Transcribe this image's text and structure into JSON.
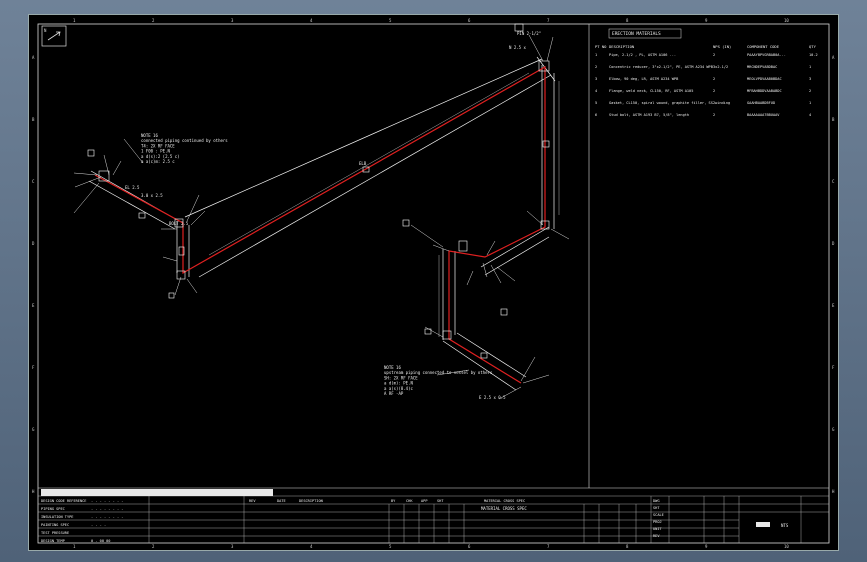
{
  "sheet": {
    "zones_top": [
      "1",
      "2",
      "3",
      "4",
      "5",
      "6",
      "7",
      "8",
      "9",
      "10"
    ],
    "zones_side": [
      "A",
      "B",
      "C",
      "D",
      "E",
      "F",
      "G",
      "H"
    ]
  },
  "bom": {
    "title": "ERECTION MATERIALS",
    "headers": [
      "PT NO",
      "DESCRIPTION",
      "NPS (IN)",
      "COMPONENT CODE",
      "QTY"
    ],
    "rows": [
      {
        "no": "1",
        "desc": "Pipe, 2-1/2 , PL, ASTM A106 ...",
        "nps": "2",
        "code": "PAAAYBPVGRBAB0A...",
        "qty": "10.2"
      },
      {
        "no": "2",
        "desc": "Concentric reducer, 3\"x2-1/2\", PE, ASTM A234 WPB",
        "nps": "3x2-1/2",
        "code": "MRCNDEPVABDBAC",
        "qty": "1"
      },
      {
        "no": "3",
        "desc": "Elbow, 90 deg, LR, ASTM A234 WPB",
        "nps": "2",
        "code": "MEOLVPDVAAB0BDAC",
        "qty": "3"
      },
      {
        "no": "4",
        "desc": "Flange, weld neck, CL150, RF, ASTM A105",
        "nps": "2",
        "code": "MFBAHBDDVAABABDC",
        "qty": "2"
      },
      {
        "no": "5",
        "desc": "Gasket, CL150, spiral wound, graphite filler, SS winding",
        "nps": "2",
        "code": "GAAHBAABDBFUD",
        "qty": "1"
      },
      {
        "no": "6",
        "desc": "Stud bolt, ASTM A193 B7, 5/8\", length",
        "nps": "2",
        "code": "BAAAAAAA7BBUAAV",
        "qty": "4"
      }
    ]
  },
  "notes": {
    "left": [
      "NOTE 16",
      "connected piping continued by others",
      "T4: 2X RF FACE",
      "1 F00 : PE.N",
      "a  d(s):2 (2.5 c)",
      "a  a(c)m: 2.5 c"
    ],
    "right": [
      "NOTE 16",
      "upstream piping connected to vessel by others",
      "SH: 2X RF FACE",
      "a  d(m): PE.N",
      "a  a(s)(8.4)c",
      "A   RF  -AP"
    ]
  },
  "callouts": [
    "PIN 2-1/2\"",
    "N 2.5 x",
    "ELB",
    "3.0 x 2.5",
    "EL 2.5",
    "BOLT 2.5",
    "E 2.5 x 0.5"
  ],
  "title_block": {
    "left_labels": [
      "DESIGN CODE REFERENCE",
      "PIPING SPEC",
      "INSULATION TYPE",
      "PAINTING SPEC",
      "TEST PRESSURE",
      "DESIGN TEMP"
    ],
    "left_values": [
      "- - - - - - - -",
      "- - - - - - - -",
      "- - - - - - - -",
      "- - - -",
      "",
      "0 . 00 00"
    ],
    "columns": [
      "REV",
      "DATE",
      "DESCRIPTION",
      "BY",
      "CHK",
      "APP",
      "SHT",
      "MATERIAL CROSS SPEC"
    ],
    "sub_row": "MATERIAL CROSS SPEC",
    "right_labels": [
      "DWG",
      "SHT",
      "SCALE",
      "PROJ",
      "UNIT",
      "REV"
    ],
    "right_mark": "NTS"
  },
  "colors": {
    "pipe": "#e02020",
    "line": "#ffffff",
    "bg": "#000000"
  }
}
